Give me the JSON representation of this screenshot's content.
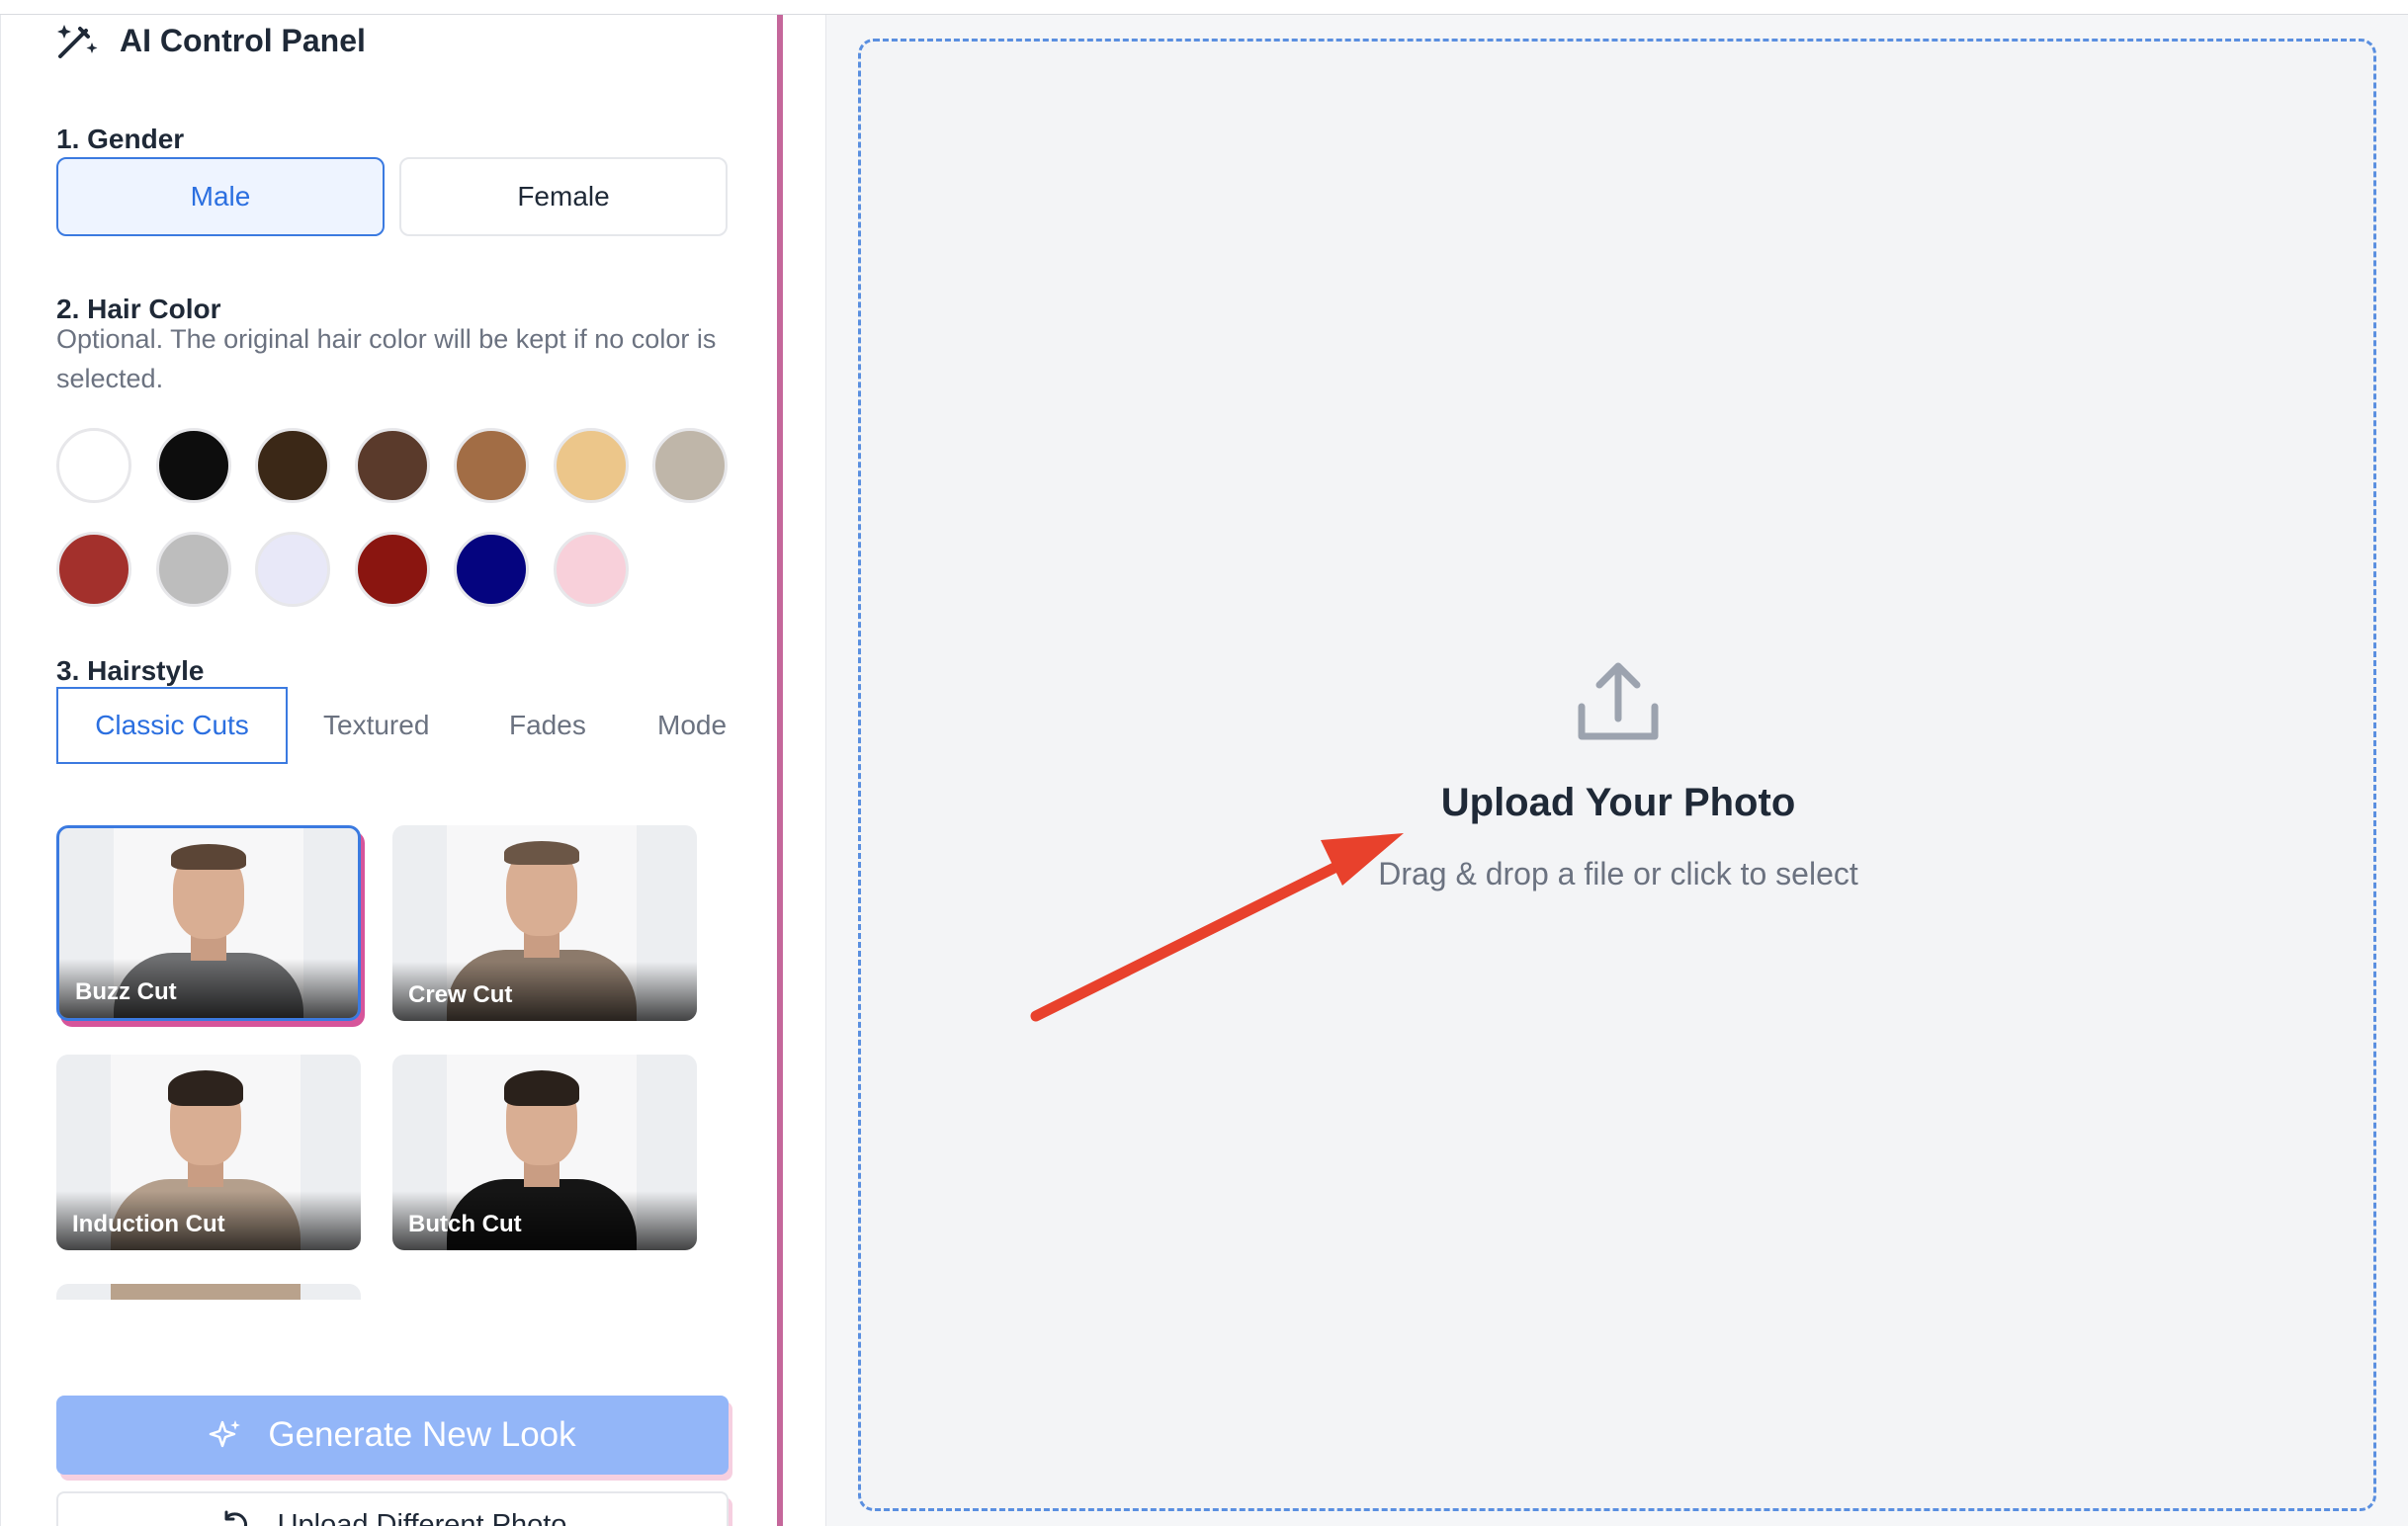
{
  "panel": {
    "title": "AI Control Panel",
    "gender": {
      "label": "1. Gender",
      "options": [
        "Male",
        "Female"
      ],
      "selected": "Male"
    },
    "hair_color": {
      "label": "2. Hair Color",
      "helper": "Optional. The original hair color will be kept if no color is selected.",
      "swatches": [
        "#ffffff",
        "#0d0d0d",
        "#3b2817",
        "#5a3a2b",
        "#a26d45",
        "#ecc68a",
        "#bfb6a9",
        "#a3302c",
        "#bdbdbd",
        "#e8e8f8",
        "#8a1510",
        "#05047f",
        "#f8d0da"
      ]
    },
    "hairstyle": {
      "label": "3. Hairstyle",
      "tabs": [
        "Classic Cuts",
        "Textured",
        "Fades",
        "Mode"
      ],
      "active_tab": "Classic Cuts",
      "cards": [
        {
          "name": "Buzz Cut",
          "selected": true
        },
        {
          "name": "Crew Cut",
          "selected": false
        },
        {
          "name": "Induction Cut",
          "selected": false
        },
        {
          "name": "Butch Cut",
          "selected": false
        }
      ]
    },
    "generate_button": "Generate New Look",
    "upload_different": "Upload Different Photo"
  },
  "upload": {
    "title": "Upload Your Photo",
    "subtitle": "Drag & drop a file or click to select"
  },
  "colors": {
    "accent": "#2b6fe0",
    "divider": "#c5679b",
    "arrow": "#e8412c"
  }
}
